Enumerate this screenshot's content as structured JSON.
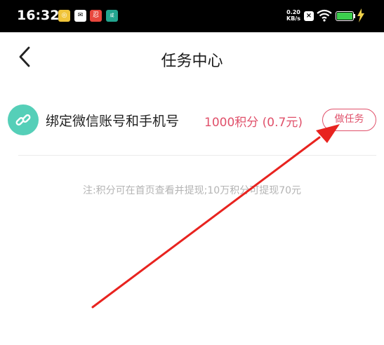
{
  "status_bar": {
    "time": "16:32",
    "net_speed_value": "0.20",
    "net_speed_unit": "KB/s",
    "sim_badge": "×",
    "app_icons": [
      "bank-app-icon",
      "mail-app-icon",
      "red-app-icon",
      "teal-app-icon"
    ],
    "app_labels": [
      "◎",
      "✉",
      "忍",
      "咸"
    ],
    "battery_color": "#3ccf4e"
  },
  "header": {
    "title": "任务中心",
    "back_icon": "chevron-left-icon"
  },
  "task": {
    "icon": "link-icon",
    "icon_color": "#55cfb8",
    "title": "绑定微信账号和手机号",
    "reward": "1000积分 (0.7元)",
    "button_label": "做任务",
    "accent_color": "#e0506a"
  },
  "note": "注:积分可在首页查看并提现;10万积分可提现70元",
  "annotation": {
    "arrow_color": "#e8231f"
  }
}
